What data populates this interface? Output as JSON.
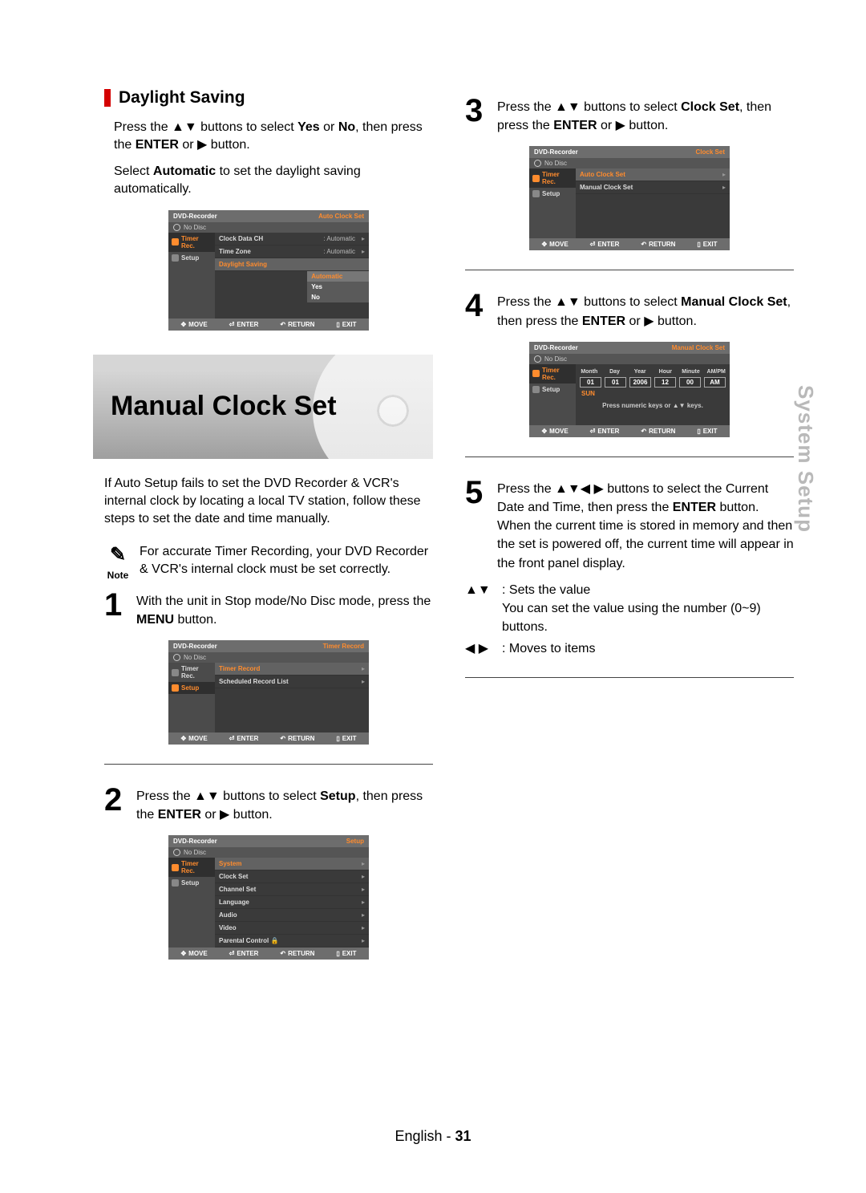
{
  "sideTab": "System Setup",
  "footer": {
    "lang": "English",
    "dash": "-",
    "page": "31"
  },
  "symbols": {
    "ud": "▲▼",
    "r": "▶",
    "lr": "◀ ▶",
    "all": "▲▼◀ ▶"
  },
  "daylight": {
    "title": "Daylight Saving",
    "p1a": "Press the ",
    "p1b": " buttons to select ",
    "p1yes": "Yes",
    "p1or": " or ",
    "p1no": "No",
    "p1c": ", then press the ",
    "p1enter": "ENTER",
    "p1or2": " or ",
    "p1d": " button.",
    "p2a": "Select ",
    "p2auto": "Automatic",
    "p2b": " to set the daylight saving automatically."
  },
  "osdDaylight": {
    "title": "DVD-Recorder",
    "mode": "Auto Clock Set",
    "disc": "No Disc",
    "side": [
      {
        "t": "Timer Rec."
      },
      {
        "t": "Setup"
      }
    ],
    "rows": [
      {
        "l": "Clock Data CH",
        "v": ": Automatic"
      },
      {
        "l": "Time Zone",
        "v": ": Automatic"
      },
      {
        "l": "Daylight Saving",
        "v": "",
        "hl": true
      }
    ],
    "drop": [
      "Automatic",
      "Yes",
      "No"
    ],
    "foot": {
      "move": "MOVE",
      "enter": "ENTER",
      "return": "RETURN",
      "exit": "EXIT"
    }
  },
  "manualBanner": "Manual Clock Set",
  "manualIntro": "If Auto Setup fails to set the DVD Recorder & VCR's internal clock by locating a local TV station, follow these steps to set the date and time manually.",
  "note": {
    "label": "Note",
    "text": "For accurate Timer Recording, your DVD Recorder & VCR's internal clock must be set correctly."
  },
  "step1": {
    "n": "1",
    "a": "With the unit in Stop mode/No Disc mode, press the ",
    "menu": "MENU",
    "b": " button."
  },
  "osdTimer": {
    "title": "DVD-Recorder",
    "mode": "Timer Record",
    "disc": "No Disc",
    "side": [
      {
        "t": "Timer Rec."
      },
      {
        "t": "Setup"
      }
    ],
    "sideSel": 1,
    "rows": [
      {
        "l": "Timer Record"
      },
      {
        "l": "Scheduled Record List"
      }
    ]
  },
  "step2": {
    "n": "2",
    "a": "Press the ",
    "b": " buttons to select ",
    "setup": "Setup",
    "c": ", then press the ",
    "enter": "ENTER",
    "d": " or ",
    "e": " button."
  },
  "osdSetup": {
    "title": "DVD-Recorder",
    "mode": "Setup",
    "disc": "No Disc",
    "side": [
      {
        "t": "Timer Rec."
      },
      {
        "t": "Setup"
      }
    ],
    "sideSel": 0,
    "rows": [
      {
        "l": "System",
        "hl": true
      },
      {
        "l": "Clock Set"
      },
      {
        "l": "Channel Set"
      },
      {
        "l": "Language"
      },
      {
        "l": "Audio"
      },
      {
        "l": "Video"
      },
      {
        "l": "Parental Control",
        "lock": true
      }
    ]
  },
  "step3": {
    "n": "3",
    "a": "Press the ",
    "b": " buttons to select ",
    "cs": "Clock Set",
    "c": ", then press the ",
    "enter": "ENTER",
    "d": " or ",
    "e": " button."
  },
  "osdClockSet": {
    "title": "DVD-Recorder",
    "mode": "Clock Set",
    "disc": "No Disc",
    "side": [
      {
        "t": "Timer Rec."
      },
      {
        "t": "Setup"
      }
    ],
    "sideSel": 0,
    "rows": [
      {
        "l": "Auto Clock Set",
        "hl": true
      },
      {
        "l": "Manual Clock Set"
      }
    ]
  },
  "step4": {
    "n": "4",
    "a": "Press the ",
    "b": " buttons to select ",
    "mcs": "Manual Clock Set",
    "c": ", then press the ",
    "enter": "ENTER",
    "d": " or ",
    "e": " button."
  },
  "osdManual": {
    "title": "DVD-Recorder",
    "mode": "Manual Clock Set",
    "disc": "No Disc",
    "side": [
      {
        "t": "Timer Rec."
      },
      {
        "t": "Setup"
      }
    ],
    "sideSel": 1,
    "headers": [
      "Month",
      "Day",
      "Year",
      "Hour",
      "Minute",
      "AM/PM"
    ],
    "values": [
      "01",
      "01",
      "2006",
      "12",
      "00",
      "AM"
    ],
    "dayName": "SUN",
    "hint": "Press numeric keys or ▲▼ keys."
  },
  "step5": {
    "n": "5",
    "a": "Press the ",
    "b": " buttons to select the Current Date and Time, then press the ",
    "enter": "ENTER",
    "c": " button.",
    "d": "When the current time is stored in memory and then the set is powered off, the current time will appear in the front panel display."
  },
  "sub": {
    "s1": {
      "sym": "▲▼",
      "a": ": Sets the value",
      "b": "You can set the value using the number (0~9) buttons."
    },
    "s2": {
      "sym": "◀ ▶",
      "a": ": Moves to items"
    }
  },
  "foot": {
    "move": "MOVE",
    "enter": "ENTER",
    "return": "RETURN",
    "exit": "EXIT"
  }
}
